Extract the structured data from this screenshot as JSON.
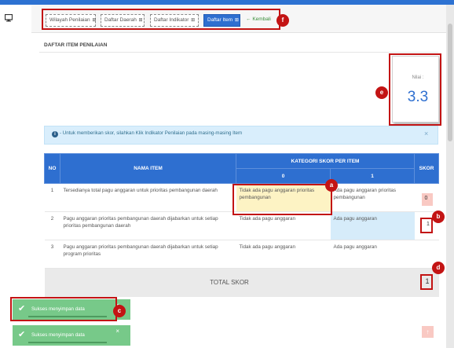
{
  "tabs": [
    {
      "label": "Wilayah Penilaian",
      "icon": "grid-icon"
    },
    {
      "label": "Daftar Daerah",
      "icon": "grid-icon"
    },
    {
      "label": "Daftar Indikator",
      "icon": "grid-icon"
    },
    {
      "label": "Daftar Item",
      "icon": "grid-icon"
    }
  ],
  "back_label": "Kembali",
  "section_title": "DAFTAR ITEM PENILAIAN",
  "nilai": {
    "label": "Nilai :",
    "value": "3.3"
  },
  "info_text": "- Untuk memberikan skor, silahkan Klik Indikator Penilaian pada masing-masing Item",
  "table": {
    "headers": {
      "no": "NO",
      "nama": "NAMA ITEM",
      "kategori": "KATEGORI SKOR PER ITEM",
      "skor": "SKOR",
      "cat0": "0",
      "cat1": "1"
    },
    "rows": [
      {
        "no": "1",
        "nama": "Tersedianya total pagu anggaran untuk prioritas pembangunan daerah",
        "c0": "Tidak ada pagu anggaran prioritas pembangunan",
        "c1": "Ada pagu anggaran prioritas pembangunan",
        "skor": "0"
      },
      {
        "no": "2",
        "nama": "Pagu anggaran prioritas pembangunan daerah dijabarkan untuk setiap prioritas pembangunan daerah",
        "c0": "Tidak ada pagu anggaran",
        "c1": "Ada pagu anggaran",
        "skor": "1"
      },
      {
        "no": "3",
        "nama": "Pagu anggaran prioritas pembangunan daerah dijabarkan untuk setiap program prioritas",
        "c0": "Tidak ada pagu anggaran",
        "c1": "Ada pagu anggaran",
        "skor": ""
      }
    ],
    "total_label": "TOTAL SKOR",
    "total_value": "1"
  },
  "toasts": [
    {
      "message": "Sukses menyimpan data"
    },
    {
      "message": "Sukses menyimpan data"
    }
  ],
  "callouts": {
    "a": "a",
    "b": "b",
    "c": "c",
    "d": "d",
    "e": "e",
    "f": "f"
  },
  "colors": {
    "primary": "#2e6fd0",
    "callout": "#c31414",
    "toast": "#77c989",
    "info_bg": "#d9eefc",
    "highlight_yellow": "#fdf3c4",
    "highlight_blue": "#d6ecfa",
    "score_pink": "#f9c9c3"
  }
}
